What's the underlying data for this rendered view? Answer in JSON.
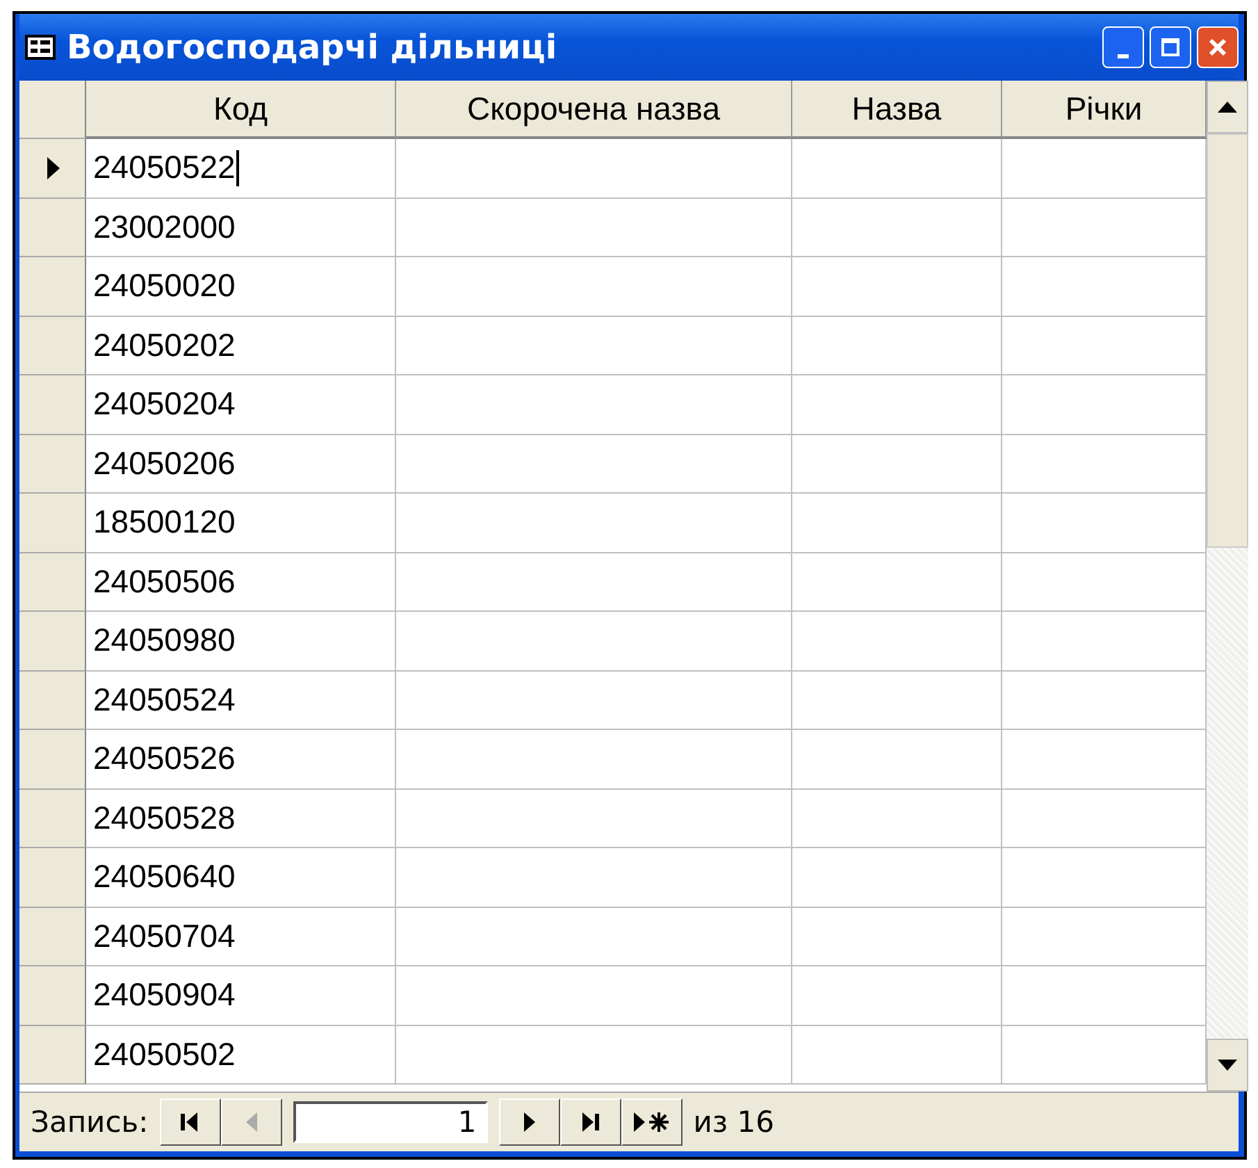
{
  "window": {
    "title": "Водогосподарчі дільниці"
  },
  "table": {
    "columns": [
      "Код",
      "Скорочена назва",
      "Назва",
      "Річки"
    ],
    "rows": [
      {
        "code": "24050522",
        "selected": true
      },
      {
        "code": "23002000",
        "selected": false
      },
      {
        "code": "24050020",
        "selected": false
      },
      {
        "code": "24050202",
        "selected": false
      },
      {
        "code": "24050204",
        "selected": false
      },
      {
        "code": "24050206",
        "selected": false
      },
      {
        "code": "18500120",
        "selected": false
      },
      {
        "code": "24050506",
        "selected": false
      },
      {
        "code": "24050980",
        "selected": false
      },
      {
        "code": "24050524",
        "selected": false
      },
      {
        "code": "24050526",
        "selected": false
      },
      {
        "code": "24050528",
        "selected": false
      },
      {
        "code": "24050640",
        "selected": false
      },
      {
        "code": "24050704",
        "selected": false
      },
      {
        "code": "24050904",
        "selected": false
      },
      {
        "code": "24050502",
        "selected": false
      }
    ]
  },
  "navigator": {
    "label": "Запись:",
    "record": "1",
    "total": "из 16",
    "buttons": [
      {
        "kind": "first",
        "disabled": false
      },
      {
        "kind": "prev",
        "disabled": true
      },
      {
        "kind": "next",
        "disabled": false
      },
      {
        "kind": "last",
        "disabled": false
      },
      {
        "kind": "new",
        "disabled": false
      }
    ]
  }
}
